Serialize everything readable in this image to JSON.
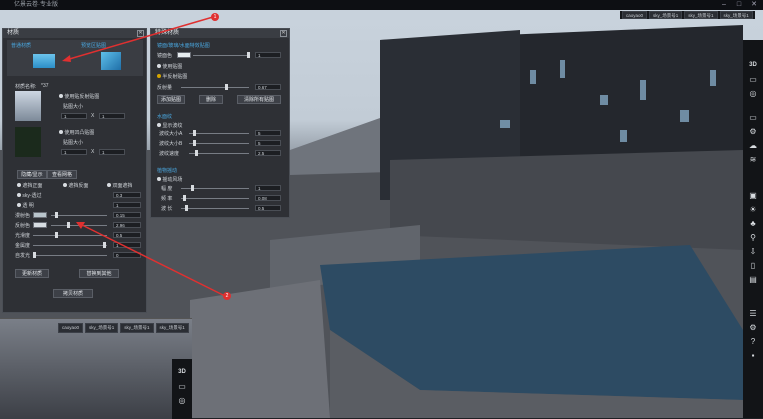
{
  "window": {
    "title": "亿景云卷·专业版"
  },
  "viewport_tabs": [
    "caoyao0",
    "sky_场景号1",
    "sky_场景号1",
    "sky_场景号1"
  ],
  "mini_tabs": [
    "caoyao0",
    "sky_场景号1",
    "sky_场景号1",
    "sky_场景号1"
  ],
  "right_toolbar": {
    "label_3d": "3D"
  },
  "mini_toolbar": {
    "label_3d": "3D"
  },
  "annotations": [
    "1",
    "2"
  ],
  "material_panel": {
    "title": "材质",
    "tab_left": "普通材质",
    "tab_right": "预览区贴图",
    "name_label": "材质名称:",
    "name_value": "*37",
    "use_reflection": "使用贴反射贴图",
    "reflect_size": "贴图大小",
    "tex_x": "1",
    "tex_x_label": "X",
    "tex_y": "1",
    "use_normal": "使用凹凸贴图",
    "bump_size": "贴图大小",
    "tex2_x": "1",
    "tex2_x_label": "X",
    "tex2_y": "1",
    "hide_show": "隐藏/显示",
    "view_grid": "查看网格",
    "opt_normal": "遮挡正面",
    "opt_back": "遮挡反面",
    "opt_double": "双面遮挡",
    "row_sky": "sky-透过",
    "row_sky_val": "0.3",
    "row_trans": "透 明",
    "row_trans_val": "1",
    "row_diffuse": "漫射色",
    "row_diffuse_val": "0.15",
    "row_reflect": "反射色",
    "row_reflect_val": "2.96",
    "row_gloss": "光滑度",
    "row_gloss_val": "0.5",
    "row_metal": "金属度",
    "row_metal_val": "1",
    "row_self": "自发光",
    "row_self_val": "0",
    "btn_refresh": "更新材质",
    "btn_similar": "替换到其他",
    "btn_sample": "拷贝材质"
  },
  "special_panel": {
    "title": "特殊材质",
    "section1": "镜面/玻璃/水面特效贴图",
    "row_color": "镜面色",
    "row_color_val": "1",
    "opt_noise": "使用贴图",
    "opt_half": "半反射贴图",
    "row_refl": "反射量",
    "row_refl_val": "0.67",
    "btn_add": "添加贴图",
    "btn_del": "删除",
    "btn_clear": "清除所有贴图",
    "section2": "水面纹",
    "opt_wave": "显示波纹",
    "wave1": "波纹大小A",
    "wave1_val": "5",
    "wave2": "波纹大小B",
    "wave2_val": "5",
    "wave3": "波纹速度",
    "wave3_val": "2.5",
    "section3": "植物摇动",
    "opt_wind": "摇动风场",
    "w1": "幅 度",
    "w1_val": "1",
    "w2": "频 率",
    "w2_val": "0.08",
    "w3": "波 长",
    "w3_val": "0.5"
  },
  "colors": {
    "accent": "#4aa8e0",
    "panel": "#2e3035",
    "marker": "#e03030"
  }
}
